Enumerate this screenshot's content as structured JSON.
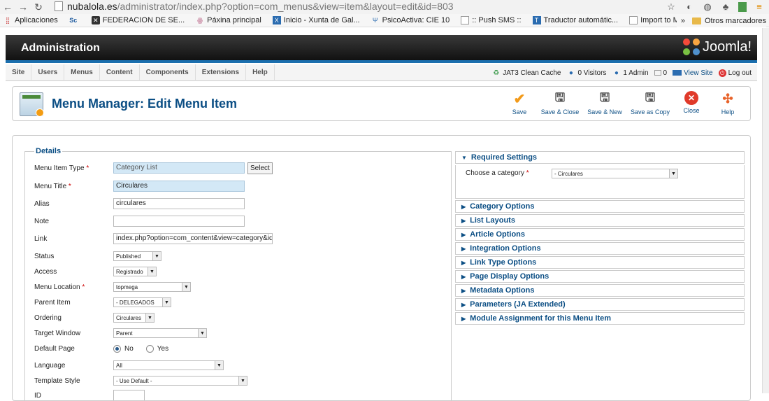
{
  "browser": {
    "url_host": "nubalola.es",
    "url_path": "/administrator/index.php?option=com_menus&view=item&layout=edit&id=803",
    "bookmarks": [
      {
        "label": "Aplicaciones",
        "icon": "apps-icon"
      },
      {
        "label": "",
        "icon": "sc-icon"
      },
      {
        "label": "FEDERACION DE SE...",
        "icon": "federacion-icon"
      },
      {
        "label": "Páxina principal",
        "icon": "paxina-icon"
      },
      {
        "label": "Inicio - Xunta de Gal...",
        "icon": "xunta-icon"
      },
      {
        "label": "PsicoActiva: CIE 10",
        "icon": "psico-icon"
      },
      {
        "label": ":: Push SMS ::",
        "icon": "page-icon"
      },
      {
        "label": "Traductor automátic...",
        "icon": "traductor-icon"
      },
      {
        "label": "Import to Mendeley",
        "icon": "page-icon"
      }
    ],
    "bookmarks_more": "»",
    "other_bookmarks": "Otros marcadores"
  },
  "header": {
    "title": "Administration",
    "logo_text": "Joomla!"
  },
  "menu": {
    "items": [
      "Site",
      "Users",
      "Menus",
      "Content",
      "Components",
      "Extensions",
      "Help"
    ]
  },
  "status": {
    "cache": "JAT3 Clean Cache",
    "visitors": "0 Visitors",
    "admins": "1 Admin",
    "messages": "0",
    "view_site": "View Site",
    "logout": "Log out"
  },
  "toolbar": {
    "title": "Menu Manager: Edit Menu Item",
    "save": "Save",
    "save_close": "Save & Close",
    "save_new": "Save & New",
    "save_copy": "Save as Copy",
    "close": "Close",
    "help": "Help"
  },
  "details": {
    "legend": "Details",
    "menu_item_type_label": "Menu Item Type",
    "menu_item_type_value": "Category List",
    "select_button": "Select",
    "menu_title_label": "Menu Title",
    "menu_title_value": "Circulares",
    "alias_label": "Alias",
    "alias_value": "circulares",
    "note_label": "Note",
    "note_value": "",
    "link_label": "Link",
    "link_value": "index.php?option=com_content&view=category&id=",
    "status_label": "Status",
    "status_value": "Published",
    "access_label": "Access",
    "access_value": "Registrado",
    "menu_location_label": "Menu Location",
    "menu_location_value": "topmega",
    "parent_label": "Parent Item",
    "parent_value": "- DELEGADOS",
    "ordering_label": "Ordering",
    "ordering_value": "Circulares",
    "target_label": "Target Window",
    "target_value": "Parent",
    "default_label": "Default Page",
    "default_no": "No",
    "default_yes": "Yes",
    "language_label": "Language",
    "language_value": "All",
    "template_label": "Template Style",
    "template_value": "- Use Default -",
    "id_label": "ID",
    "required_mark": "*"
  },
  "right": {
    "required_settings": "Required Settings",
    "choose_category_label": "Choose a category",
    "choose_category_value": "- Circulares",
    "sections": [
      "Category Options",
      "List Layouts",
      "Article Options",
      "Integration Options",
      "Link Type Options",
      "Page Display Options",
      "Metadata Options",
      "Parameters (JA Extended)",
      "Module Assignment for this Menu Item"
    ]
  },
  "colors": {
    "accent_blue": "#0b4e84",
    "header_dark": "#111111",
    "header_stripe": "#1b6fae",
    "highlight_field": "#d3e8f6",
    "required_red": "#cc0000"
  }
}
